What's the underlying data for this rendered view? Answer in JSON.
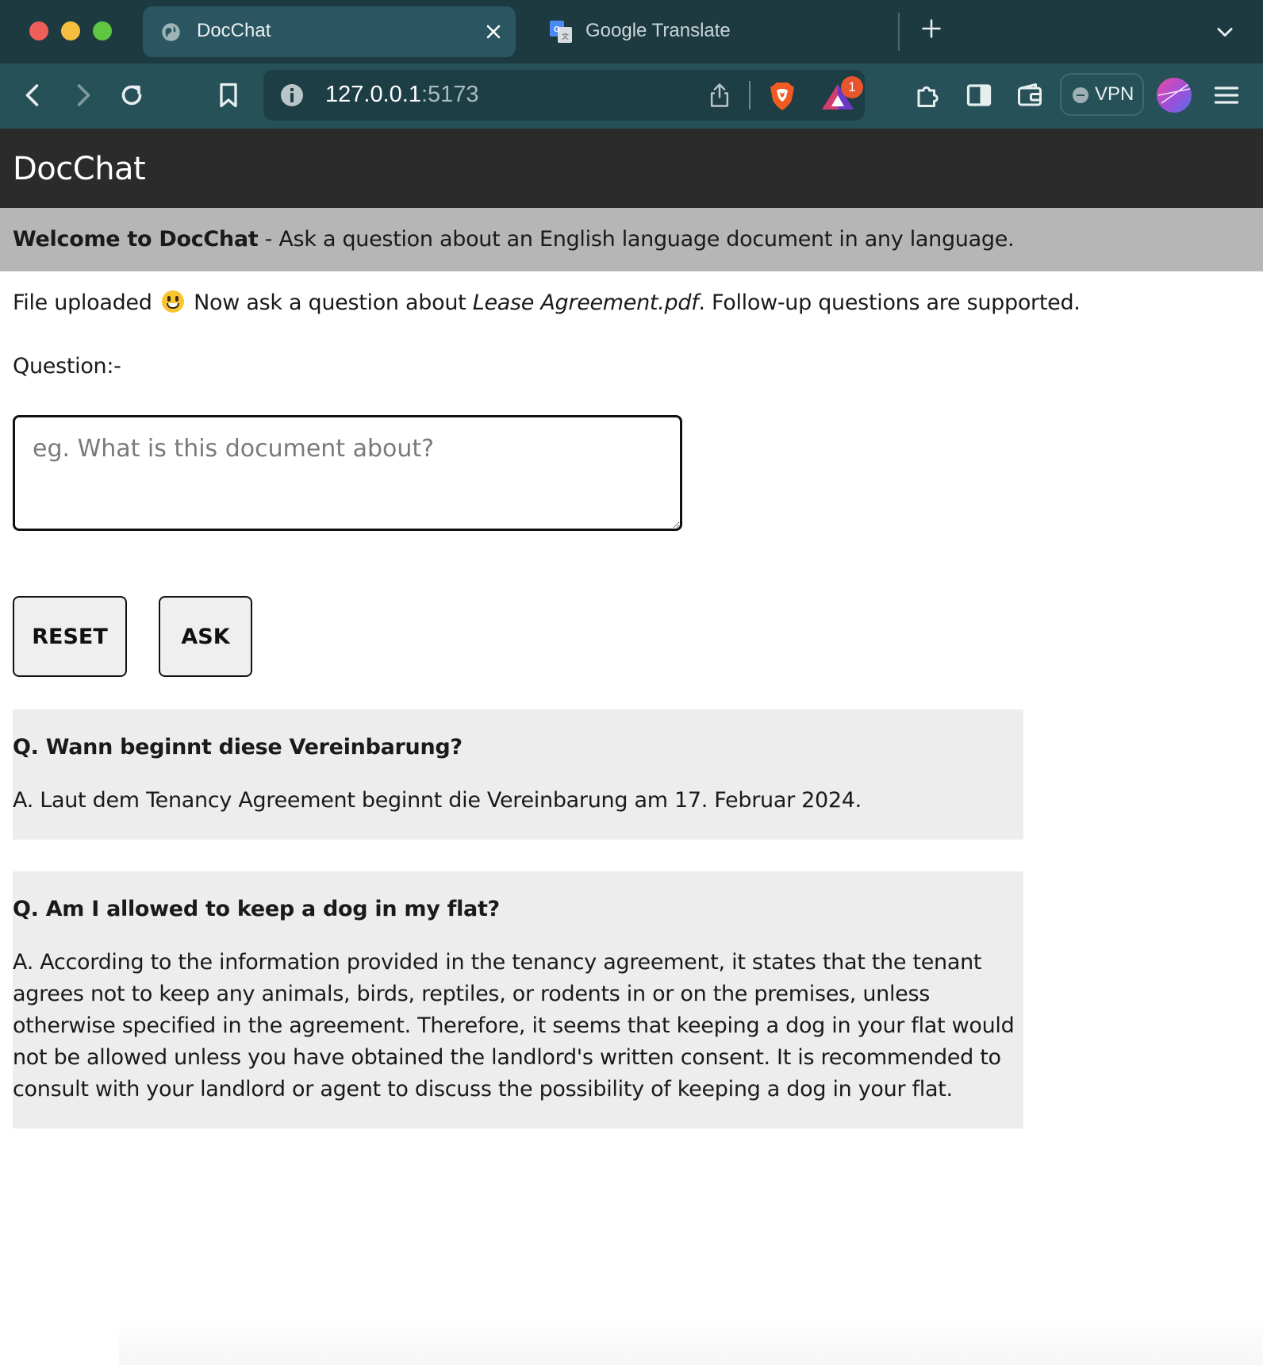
{
  "browser": {
    "tabs": [
      {
        "title": "DocChat",
        "icon": "globe-icon",
        "active": true
      },
      {
        "title": "Google Translate",
        "icon": "google-translate-icon",
        "active": false
      }
    ],
    "url": {
      "host": "127.0.0.1",
      "port": ":5173"
    },
    "vpn_label": "VPN",
    "rewards_badge": "1"
  },
  "app": {
    "title": "DocChat",
    "welcome": {
      "bold": "Welcome to DocChat",
      "rest": " - Ask a question about an English language document in any language."
    },
    "status": {
      "prefix": "File uploaded",
      "middle": " Now ask a question about ",
      "filename": "Lease Agreement.pdf",
      "suffix": ". Follow-up questions are supported."
    },
    "question_label": "Question:-",
    "question_placeholder": "eg. What is this document about?",
    "buttons": {
      "reset": "RESET",
      "ask": "ASK"
    },
    "qa": [
      {
        "q": "Q. Wann beginnt diese Vereinbarung?",
        "a": "A. Laut dem Tenancy Agreement beginnt die Vereinbarung am 17. Februar 2024."
      },
      {
        "q": "Q. Am I allowed to keep a dog in my flat?",
        "a": "A. According to the information provided in the tenancy agreement, it states that the tenant agrees not to keep any animals, birds, reptiles, or rodents in or on the premises, unless otherwise specified in the agreement. Therefore, it seems that keeping a dog in your flat would not be allowed unless you have obtained the landlord's written consent. It is recommended to consult with your landlord or agent to discuss the possibility of keeping a dog in your flat."
      }
    ]
  }
}
